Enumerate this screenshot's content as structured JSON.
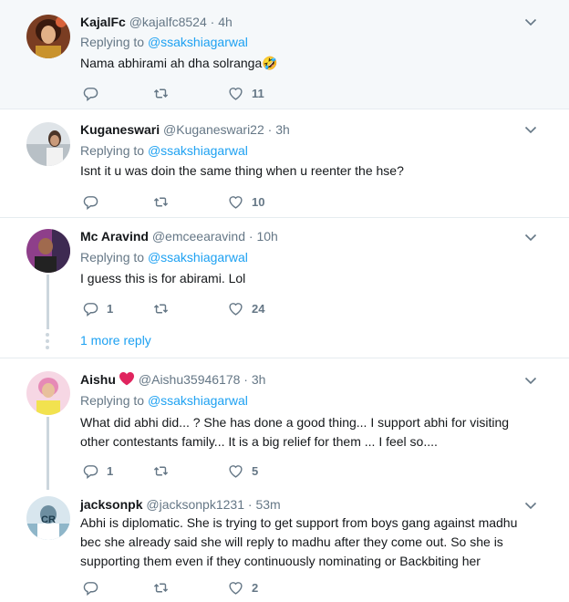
{
  "tweets": [
    {
      "name": "KajalFc",
      "handle": "@kajalfc8524",
      "sep": " · ",
      "time": "4h",
      "replying_label": "Replying to ",
      "replying_to": "@ssakshiagarwal",
      "text": "Nama abhirami ah dha solranga🤣",
      "replies": "",
      "retweets": "",
      "likes": "11"
    },
    {
      "name": "Kuganeswari",
      "handle": "@Kuganeswari22",
      "sep": " · ",
      "time": "3h",
      "replying_label": "Replying to ",
      "replying_to": "@ssakshiagarwal",
      "text": "Isnt it u was doin the same thing when u reenter the hse?",
      "replies": "",
      "retweets": "",
      "likes": "10"
    },
    {
      "name": "Mc Aravind",
      "handle": "@emceearavind",
      "sep": " · ",
      "time": "10h",
      "replying_label": "Replying to ",
      "replying_to": "@ssakshiagarwal",
      "text": "I guess this is for abirami. Lol",
      "replies": "1",
      "retweets": "",
      "likes": "24",
      "more_replies": "1 more reply"
    },
    {
      "name": "Aishu",
      "handle": "@Aishu35946178",
      "sep": " · ",
      "time": "3h",
      "replying_label": "Replying to ",
      "replying_to": "@ssakshiagarwal",
      "text": "What did abhi did... ? She has done a good thing... I support abhi for visiting other contestants family... It is a big relief for them ... I feel so....",
      "replies": "1",
      "retweets": "",
      "likes": "5"
    },
    {
      "name": "jacksonpk",
      "handle": "@jacksonpk1231",
      "sep": " · ",
      "time": "53m",
      "text": "Abhi is diplomatic. She is trying to get support from boys gang against madhu bec she already said she will reply to madhu after they come out. So she is supporting them even if they continuously nominating or Backbiting her",
      "replies": "",
      "retweets": "",
      "likes": "2"
    }
  ],
  "avatar_overlay_text": "CR",
  "colors": {
    "link": "#1da1f2",
    "muted": "#657786",
    "text": "#14171a",
    "highlight_bg": "#f5f8fa",
    "divider": "#e6ecf0",
    "heart": "#e0245e"
  },
  "icons": {
    "reply": "reply-icon",
    "retweet": "retweet-icon",
    "like": "heart-icon",
    "menu": "chevron-down-icon"
  }
}
